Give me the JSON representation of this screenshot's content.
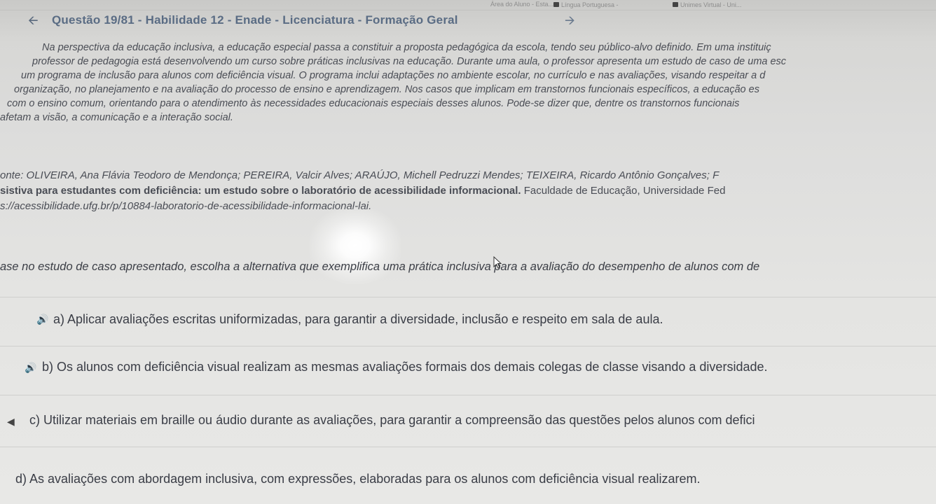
{
  "browser": {
    "bookmarks": [
      "Área do Aluno - Esta...",
      "Língua Portuguesa -",
      "Unimes Virtual - Uni..."
    ]
  },
  "header": {
    "title": "Questão 19/81 - Habilidade 12 - Enade - Licenciatura - Formação Geral"
  },
  "statement": {
    "lines": [
      "Na perspectiva da educação inclusiva, a educação especial passa a constituir a proposta pedagógica da escola, tendo seu público-alvo definido. Em uma instituiç",
      "professor de pedagogia está desenvolvendo um curso sobre práticas inclusivas na educação. Durante uma aula, o professor apresenta um estudo de caso de uma esc",
      "um programa de inclusão para alunos com deficiência visual. O programa inclui adaptações no ambiente escolar, no currículo e nas avaliações, visando respeitar a d",
      "organização, no planejamento e na avaliação do processo de ensino e aprendizagem. Nos casos que implicam em transtornos funcionais específicos, a educação es",
      "com o ensino comum, orientando para o atendimento às necessidades educacionais especiais desses alunos. Pode-se dizer que, dentre os transtornos funcionais",
      "afetam a visão, a comunicação e a interação social."
    ]
  },
  "source": {
    "line1": "onte: OLIVEIRA, Ana Flávia Teodoro de Mendonça; PEREIRA, Valcir Alves; ARAÚJO, Michell Pedruzzi Mendes; TEIXEIRA, Ricardo Antônio Gonçalves; F",
    "line2_bold": "sistiva para estudantes com deficiência: um estudo sobre o laboratório de acessibilidade informacional.",
    "line2_rest": " Faculdade de Educação, Universidade Fed",
    "line3": "s://acessibilidade.ufg.br/p/10884-laboratorio-de-acessibilidade-informacional-lai."
  },
  "question": {
    "text": "ase no estudo de caso apresentado, escolha a alternativa que exemplifica uma prática inclusiva para a avaliação do desempenho de alunos com de"
  },
  "options": [
    {
      "text": "a) Aplicar avaliações escritas uniformizadas, para garantir a diversidade, inclusão e respeito em sala de aula."
    },
    {
      "text": "b) Os alunos com deficiência visual realizam as mesmas avaliações formais dos demais colegas de classe visando a diversidade."
    },
    {
      "text": "c) Utilizar materiais em braille ou áudio durante as avaliações, para garantir a compreensão das questões pelos alunos com defici"
    },
    {
      "text": "d) As avaliações com abordagem inclusiva, com expressões, elaboradas para os alunos com deficiência visual realizarem."
    }
  ]
}
